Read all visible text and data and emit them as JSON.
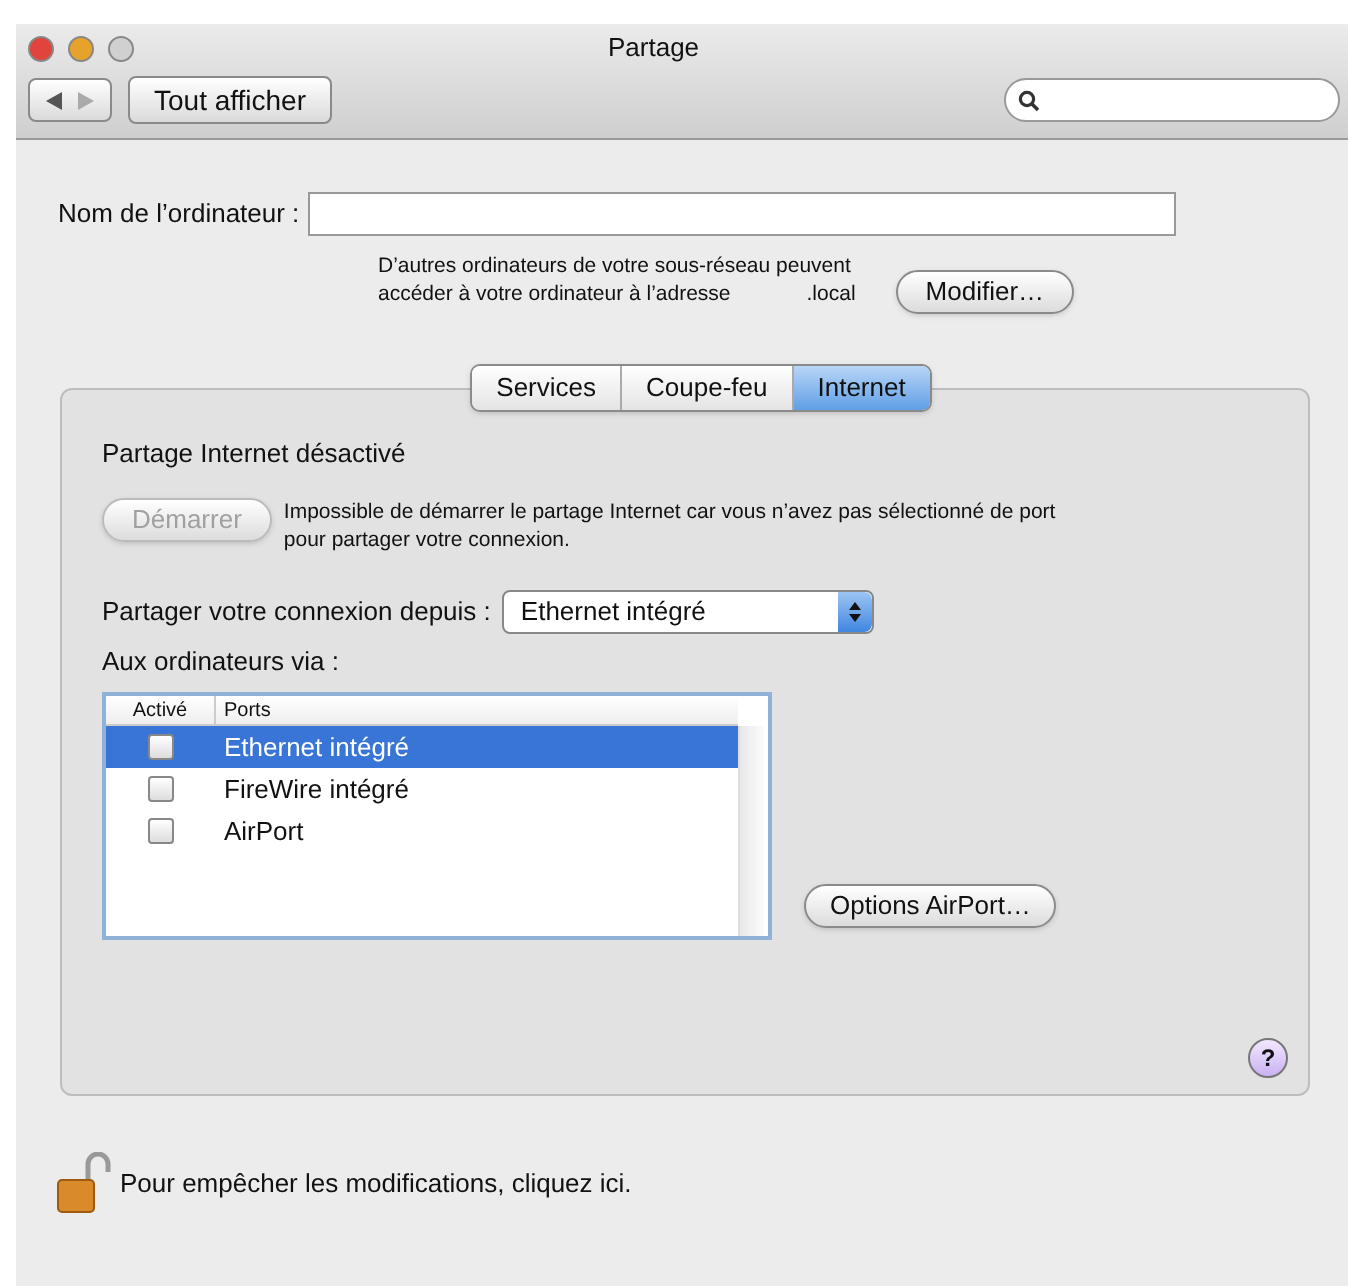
{
  "window": {
    "title": "Partage"
  },
  "toolbar": {
    "show_all": "Tout afficher"
  },
  "computer_name": {
    "label": "Nom de l’ordinateur :",
    "note_line1": "D’autres ordinateurs de votre sous-réseau peuvent",
    "note_line2": "accéder à votre ordinateur à l’adresse",
    "suffix": ".local",
    "button": "Modifier…"
  },
  "tabs": [
    {
      "label": "Services",
      "selected": false
    },
    {
      "label": "Coupe-feu",
      "selected": false
    },
    {
      "label": "Internet",
      "selected": true
    }
  ],
  "internet": {
    "status": "Partage Internet désactivé",
    "start_button": {
      "label": "Démarrer",
      "disabled": true
    },
    "message": "Impossible de démarrer le partage Internet car vous n’avez pas sélectionné de port pour partager votre connexion.",
    "share_from_label": "Partager votre connexion depuis :",
    "share_from_value": "Ethernet intégré",
    "to_label": "Aux ordinateurs via :",
    "table": {
      "columns": [
        "Activé",
        "Ports"
      ],
      "rows": [
        {
          "checked": false,
          "port": "Ethernet intégré",
          "selected": true
        },
        {
          "checked": false,
          "port": "FireWire intégré",
          "selected": false
        },
        {
          "checked": false,
          "port": "AirPort",
          "selected": false
        }
      ]
    },
    "airport_button": "Options AirPort…",
    "help": "?"
  },
  "lock": {
    "locked": false,
    "text": "Pour empêcher les modifications, cliquez ici."
  }
}
